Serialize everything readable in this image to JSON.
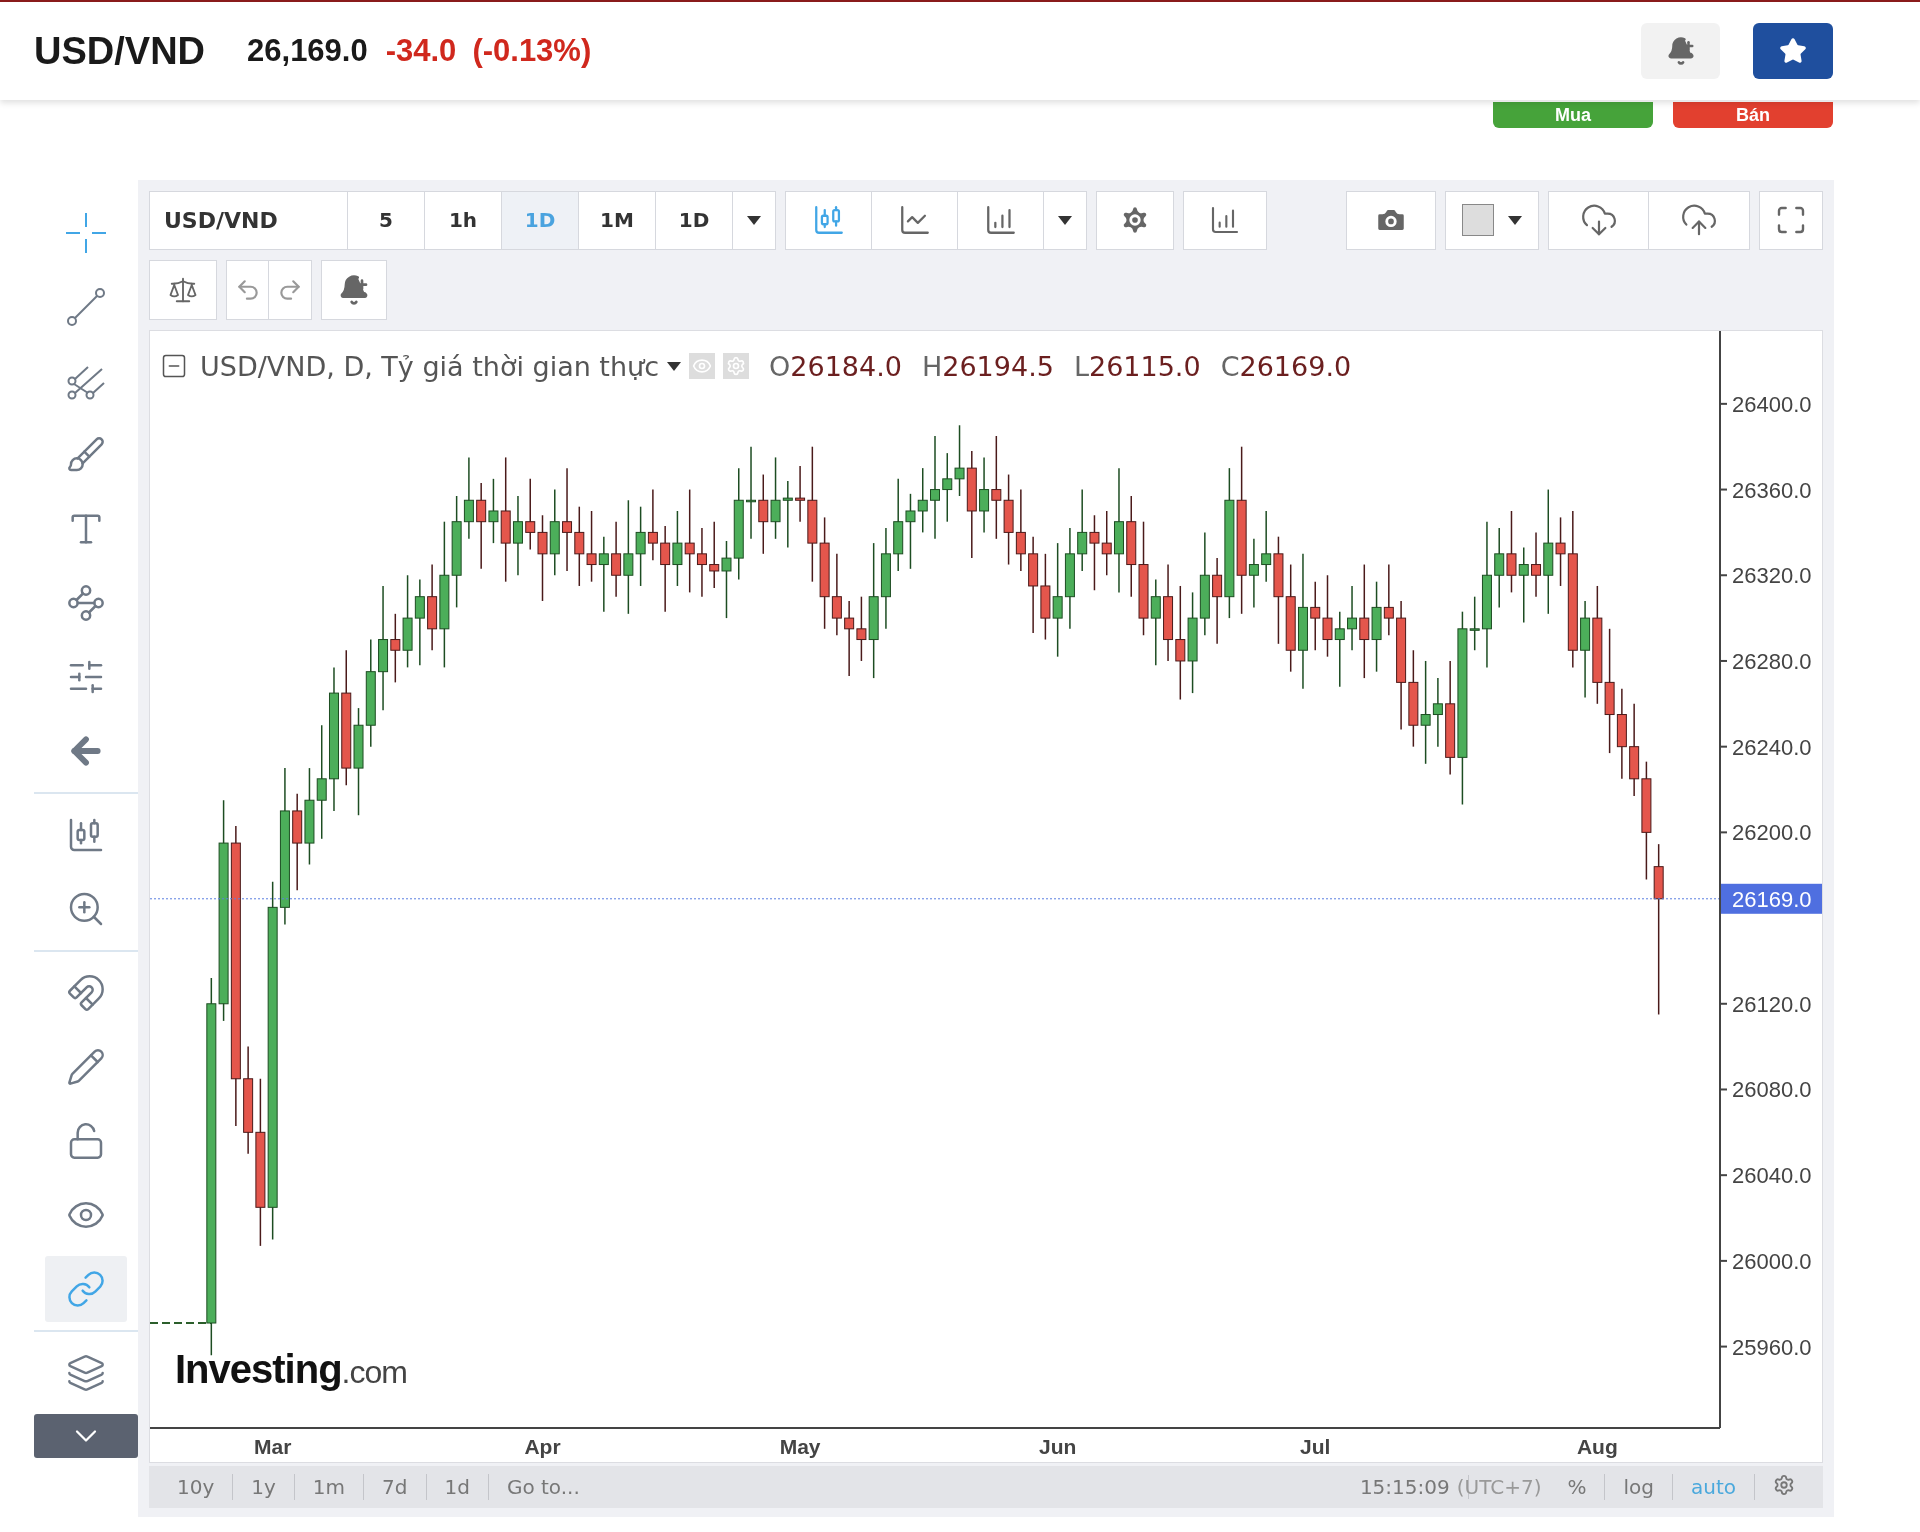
{
  "header": {
    "symbol": "USD/VND",
    "price": "26,169.0",
    "change": "-34.0",
    "change_percent": "(-0.13%)"
  },
  "trade_buttons": [
    {
      "label": "Mua",
      "kind": "buy"
    },
    {
      "label": "Bán",
      "kind": "sell"
    }
  ],
  "left_toolbar": {
    "groups": [
      {
        "tools": [
          {
            "kind": "crosshair",
            "active": true
          },
          {
            "kind": "trend_line",
            "active": false
          },
          {
            "kind": "pitchfork",
            "active": false
          },
          {
            "kind": "brush",
            "active": false
          },
          {
            "kind": "text",
            "active": false
          },
          {
            "kind": "pattern",
            "active": false
          },
          {
            "kind": "measure",
            "active": false
          },
          {
            "kind": "arrow",
            "active": false
          }
        ]
      },
      {
        "tools": [
          {
            "kind": "ruler",
            "active": false
          },
          {
            "kind": "zoom",
            "active": false
          }
        ]
      },
      {
        "tools": [
          {
            "kind": "magnet",
            "active": false
          },
          {
            "kind": "lock_drawings",
            "active": false
          },
          {
            "kind": "lock",
            "active": false
          },
          {
            "kind": "visibility",
            "active": false
          },
          {
            "kind": "link",
            "active": true
          }
        ]
      },
      {
        "tools": [
          {
            "kind": "layers",
            "active": false
          },
          {
            "kind": "collapse"
          }
        ]
      }
    ]
  },
  "toolbar": {
    "symbol": "USD/VND",
    "intervals": [
      {
        "label": "5",
        "selected": false
      },
      {
        "label": "1h",
        "selected": false
      },
      {
        "label": "1D",
        "selected": true
      },
      {
        "label": "1M",
        "selected": false
      },
      {
        "label": "1D",
        "selected": false
      }
    ],
    "chart_types": [
      {
        "kind": "candles",
        "selected": true
      },
      {
        "kind": "area",
        "selected": false
      },
      {
        "kind": "bars",
        "selected": false
      }
    ]
  },
  "legend": {
    "title": "USD/VND, D, Tỷ giá thời gian thực",
    "ohlc": [
      {
        "label": "O",
        "value": "26184.0"
      },
      {
        "label": "H",
        "value": "26194.5"
      },
      {
        "label": "L",
        "value": "26115.0"
      },
      {
        "label": "C",
        "value": "26169.0"
      }
    ]
  },
  "chart": {
    "logo": {
      "name": "Investing",
      "suffix": ".com"
    },
    "chart_data": {
      "type": "candlestick",
      "ylim": [
        25922,
        26434
      ],
      "ref_lines": [
        {
          "axis": "y",
          "value": 26169,
          "label": "26169.0"
        }
      ],
      "categories": [
        null,
        null,
        null,
        null,
        null,
        "Mar",
        null,
        null,
        null,
        null,
        null,
        null,
        null,
        null,
        null,
        null,
        null,
        null,
        null,
        null,
        null,
        null,
        null,
        null,
        null,
        null,
        null,
        "Apr",
        null,
        null,
        null,
        null,
        null,
        null,
        null,
        null,
        null,
        null,
        null,
        null,
        null,
        null,
        null,
        null,
        null,
        null,
        null,
        null,
        "May",
        null,
        null,
        null,
        null,
        null,
        null,
        null,
        null,
        null,
        null,
        null,
        null,
        null,
        null,
        null,
        null,
        null,
        null,
        null,
        null,
        "Jun",
        null,
        null,
        null,
        null,
        null,
        null,
        null,
        null,
        null,
        null,
        null,
        null,
        null,
        null,
        null,
        null,
        null,
        null,
        null,
        null,
        "Jul",
        null,
        null,
        null,
        null,
        null,
        null,
        null,
        null,
        null,
        null,
        null,
        null,
        null,
        null,
        null,
        null,
        null,
        null,
        null,
        null,
        null,
        null,
        "Aug",
        null,
        null,
        null,
        null,
        null
      ],
      "yticks": [
        {
          "value": 26400,
          "label": "26400.0"
        },
        {
          "value": 26360,
          "label": "26360.0"
        },
        {
          "value": 26320,
          "label": "26320.0"
        },
        {
          "value": 26280,
          "label": "26280.0"
        },
        {
          "value": 26240,
          "label": "26240.0"
        },
        {
          "value": 26200,
          "label": "26200.0"
        },
        {
          "value": 26120,
          "label": "26120.0"
        },
        {
          "value": 26080,
          "label": "26080.0"
        },
        {
          "value": 26040,
          "label": "26040.0"
        },
        {
          "value": 26000,
          "label": "26000.0"
        },
        {
          "value": 25960,
          "label": "25960.0"
        }
      ],
      "ohlc": [
        [
          25971,
          26132,
          25956,
          26120
        ],
        [
          26120,
          26215,
          26112,
          26195
        ],
        [
          26195,
          26203,
          26063,
          26085
        ],
        [
          26085,
          26100,
          26050,
          26060
        ],
        [
          26060,
          26085,
          26007,
          26025
        ],
        [
          26025,
          26177,
          26010,
          26165
        ],
        [
          26165,
          26230,
          26157,
          26210
        ],
        [
          26210,
          26218,
          26173,
          26195
        ],
        [
          26195,
          26230,
          26185,
          26215
        ],
        [
          26215,
          26250,
          26197,
          26225
        ],
        [
          26225,
          26277,
          26210,
          26265
        ],
        [
          26265,
          26285,
          26222,
          26230
        ],
        [
          26230,
          26258,
          26208,
          26250
        ],
        [
          26250,
          26290,
          26240,
          26275
        ],
        [
          26275,
          26315,
          26257,
          26290
        ],
        [
          26290,
          26302,
          26270,
          26285
        ],
        [
          26285,
          26320,
          26277,
          26300
        ],
        [
          26300,
          26318,
          26278,
          26310
        ],
        [
          26310,
          26325,
          26285,
          26295
        ],
        [
          26295,
          26345,
          26277,
          26320
        ],
        [
          26320,
          26357,
          26305,
          26345
        ],
        [
          26345,
          26375,
          26337,
          26355
        ],
        [
          26355,
          26363,
          26323,
          26345
        ],
        [
          26345,
          26365,
          26335,
          26350
        ],
        [
          26350,
          26375,
          26317,
          26335
        ],
        [
          26335,
          26357,
          26320,
          26345
        ],
        [
          26345,
          26365,
          26332,
          26340
        ],
        [
          26340,
          26348,
          26308,
          26330
        ],
        [
          26330,
          26360,
          26320,
          26345
        ],
        [
          26345,
          26370,
          26322,
          26340
        ],
        [
          26340,
          26352,
          26315,
          26330
        ],
        [
          26330,
          26350,
          26317,
          26325
        ],
        [
          26325,
          26338,
          26303,
          26330
        ],
        [
          26330,
          26345,
          26310,
          26320
        ],
        [
          26320,
          26355,
          26302,
          26330
        ],
        [
          26330,
          26352,
          26315,
          26340
        ],
        [
          26340,
          26360,
          26327,
          26335
        ],
        [
          26335,
          26343,
          26303,
          26325
        ],
        [
          26325,
          26350,
          26315,
          26335
        ],
        [
          26335,
          26360,
          26312,
          26330
        ],
        [
          26330,
          26342,
          26310,
          26325
        ],
        [
          26325,
          26345,
          26314,
          26322
        ],
        [
          26322,
          26336,
          26300,
          26328
        ],
        [
          26328,
          26370,
          26318,
          26355
        ],
        [
          26355,
          26380,
          26337,
          26355
        ],
        [
          26355,
          26367,
          26330,
          26345
        ],
        [
          26345,
          26375,
          26337,
          26355
        ],
        [
          26355,
          26364,
          26333,
          26356
        ],
        [
          26356,
          26371,
          26345,
          26355
        ],
        [
          26355,
          26380,
          26317,
          26335
        ],
        [
          26335,
          26347,
          26295,
          26310
        ],
        [
          26310,
          26330,
          26292,
          26300
        ],
        [
          26300,
          26308,
          26273,
          26295
        ],
        [
          26295,
          26310,
          26280,
          26290
        ],
        [
          26290,
          26335,
          26272,
          26310
        ],
        [
          26310,
          26342,
          26295,
          26330
        ],
        [
          26330,
          26365,
          26322,
          26345
        ],
        [
          26345,
          26358,
          26323,
          26350
        ],
        [
          26350,
          26370,
          26340,
          26355
        ],
        [
          26355,
          26385,
          26337,
          26360
        ],
        [
          26360,
          26377,
          26345,
          26365
        ],
        [
          26365,
          26390,
          26357,
          26370
        ],
        [
          26370,
          26378,
          26328,
          26350
        ],
        [
          26350,
          26375,
          26340,
          26360
        ],
        [
          26360,
          26385,
          26337,
          26355
        ],
        [
          26355,
          26367,
          26325,
          26340
        ],
        [
          26340,
          26360,
          26322,
          26330
        ],
        [
          26330,
          26338,
          26293,
          26315
        ],
        [
          26315,
          26330,
          26290,
          26300
        ],
        [
          26300,
          26335,
          26282,
          26310
        ],
        [
          26310,
          26342,
          26295,
          26330
        ],
        [
          26330,
          26360,
          26322,
          26340
        ],
        [
          26340,
          26348,
          26313,
          26335
        ],
        [
          26335,
          26350,
          26320,
          26330
        ],
        [
          26330,
          26370,
          26312,
          26345
        ],
        [
          26345,
          26357,
          26310,
          26325
        ],
        [
          26325,
          26345,
          26292,
          26300
        ],
        [
          26300,
          26318,
          26278,
          26310
        ],
        [
          26310,
          26325,
          26280,
          26290
        ],
        [
          26290,
          26315,
          26262,
          26280
        ],
        [
          26280,
          26312,
          26265,
          26300
        ],
        [
          26300,
          26340,
          26292,
          26320
        ],
        [
          26320,
          26328,
          26288,
          26310
        ],
        [
          26310,
          26370,
          26300,
          26355
        ],
        [
          26355,
          26380,
          26302,
          26320
        ],
        [
          26320,
          26337,
          26305,
          26325
        ],
        [
          26325,
          26350,
          26317,
          26330
        ],
        [
          26330,
          26338,
          26288,
          26310
        ],
        [
          26310,
          26325,
          26275,
          26285
        ],
        [
          26285,
          26330,
          26267,
          26305
        ],
        [
          26305,
          26317,
          26285,
          26300
        ],
        [
          26300,
          26320,
          26282,
          26290
        ],
        [
          26290,
          26303,
          26268,
          26295
        ],
        [
          26295,
          26315,
          26285,
          26300
        ],
        [
          26300,
          26325,
          26272,
          26290
        ],
        [
          26290,
          26317,
          26275,
          26305
        ],
        [
          26305,
          26325,
          26292,
          26300
        ],
        [
          26300,
          26308,
          26248,
          26270
        ],
        [
          26270,
          26285,
          26240,
          26250
        ],
        [
          26250,
          26280,
          26232,
          26255
        ],
        [
          26255,
          26272,
          26240,
          26260
        ],
        [
          26260,
          26280,
          26227,
          26235
        ],
        [
          26235,
          26303,
          26213,
          26295
        ],
        [
          26295,
          26310,
          26285,
          26295
        ],
        [
          26295,
          26345,
          26277,
          26320
        ],
        [
          26320,
          26342,
          26305,
          26330
        ],
        [
          26330,
          26350,
          26312,
          26320
        ],
        [
          26320,
          26333,
          26298,
          26325
        ],
        [
          26325,
          26340,
          26310,
          26320
        ],
        [
          26320,
          26360,
          26302,
          26335
        ],
        [
          26335,
          26347,
          26315,
          26330
        ],
        [
          26330,
          26350,
          26277,
          26285
        ],
        [
          26285,
          26308,
          26263,
          26300
        ],
        [
          26300,
          26315,
          26260,
          26270
        ],
        [
          26270,
          26295,
          26237,
          26255
        ],
        [
          26255,
          26267,
          26225,
          26240
        ],
        [
          26240,
          26260,
          26217,
          26225
        ],
        [
          26225,
          26233,
          26178,
          26200
        ],
        [
          26184,
          26194.5,
          26115,
          26169
        ]
      ]
    }
  },
  "bottom_bar": {
    "ranges": [
      "10y",
      "1y",
      "1m",
      "7d",
      "1d"
    ],
    "goto": "Go to...",
    "time": "15:15:09",
    "timezone": "(UTC+7)",
    "scale_options": [
      {
        "label": "%",
        "selected": false
      },
      {
        "label": "log",
        "selected": false
      },
      {
        "label": "auto",
        "selected": true
      }
    ]
  }
}
